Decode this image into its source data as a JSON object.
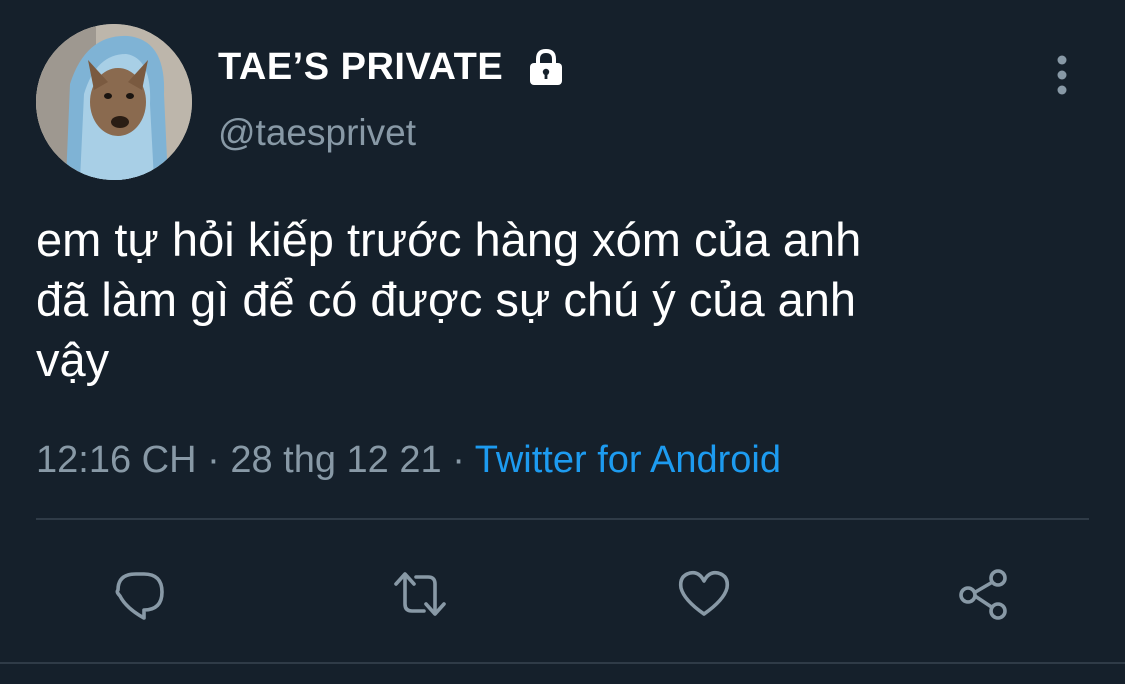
{
  "tweet": {
    "display_name": "TAE’S PRIVATE",
    "handle": "@taesprivet",
    "protected": true,
    "text": "em tự hỏi kiếp trước hàng xóm của anh\nđã làm gì để có được sự chú ý của anh\nvậy",
    "time": "12:16 CH",
    "separator": " · ",
    "date": "28 thg 12 21",
    "source": "Twitter for Android"
  },
  "icons": {
    "lock": "lock-icon",
    "more": "more-vertical-icon",
    "reply": "reply-icon",
    "retweet": "retweet-icon",
    "like": "heart-icon",
    "share": "share-icon"
  },
  "colors": {
    "background": "#15202b",
    "text": "#ffffff",
    "secondary": "#8899a6",
    "link": "#1d9bf0",
    "divider": "#2f3b47"
  }
}
